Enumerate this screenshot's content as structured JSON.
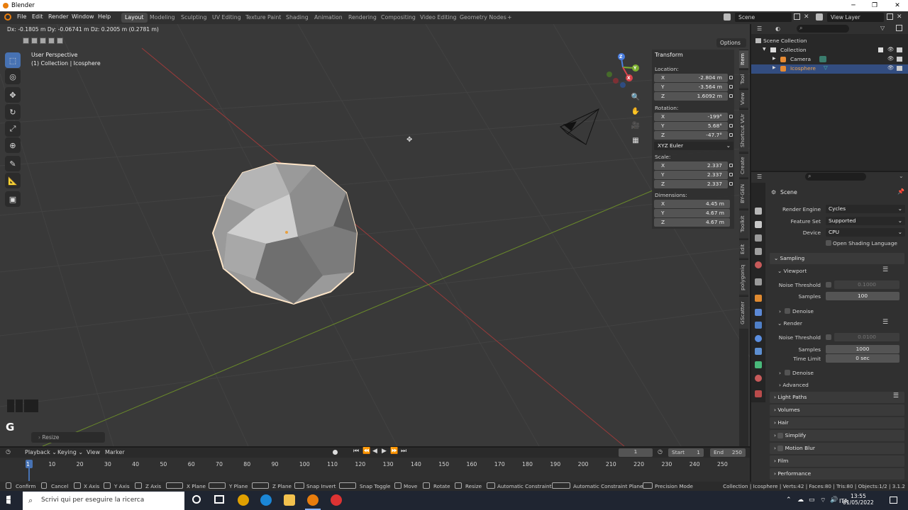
{
  "window": {
    "title": "Blender",
    "min": "─",
    "max": "❐",
    "close": "✕"
  },
  "menu": {
    "items": [
      "File",
      "Edit",
      "Render",
      "Window",
      "Help"
    ]
  },
  "workspaces": [
    "Layout",
    "Modeling",
    "Sculpting",
    "UV Editing",
    "Texture Paint",
    "Shading",
    "Animation",
    "Rendering",
    "Compositing",
    "Video Editing",
    "Geometry Nodes",
    "+"
  ],
  "scene": {
    "name": "Scene",
    "view_layer": "View Layer"
  },
  "viewport": {
    "status": "Dx: -0.1805 m  Dy: -0.06741 m  Dz: 0.2005 m (0.2781 m)",
    "perspective": "User Perspective",
    "collection_info": "(1) Collection | Icosphere",
    "options_label": "Options",
    "gizmo_x": "X",
    "gizmo_y": "Y",
    "gizmo_z": "Z",
    "grab_key": "G",
    "last_op": "Resize"
  },
  "npanel": {
    "title": "Transform",
    "location_label": "Location:",
    "location": [
      {
        "k": "X",
        "v": "-2.804 m"
      },
      {
        "k": "Y",
        "v": "-3.564 m"
      },
      {
        "k": "Z",
        "v": "1.6092 m"
      }
    ],
    "rotation_label": "Rotation:",
    "rotation": [
      {
        "k": "X",
        "v": "-199°"
      },
      {
        "k": "Y",
        "v": "5.68°"
      },
      {
        "k": "Z",
        "v": "-47.7°"
      }
    ],
    "rotation_mode": "XYZ Euler",
    "scale_label": "Scale:",
    "scale": [
      {
        "k": "X",
        "v": "2.337"
      },
      {
        "k": "Y",
        "v": "2.337"
      },
      {
        "k": "Z",
        "v": "2.337"
      }
    ],
    "dimensions_label": "Dimensions:",
    "dimensions": [
      {
        "k": "X",
        "v": "4.45 m"
      },
      {
        "k": "Y",
        "v": "4.67 m"
      },
      {
        "k": "Z",
        "v": "4.67 m"
      }
    ]
  },
  "sidebar_tabs": [
    "Item",
    "Tool",
    "View",
    "Shortcut VUr",
    "Create",
    "BY-GEN",
    "Toolkit",
    "Edit",
    "polygoniq",
    "GScatter"
  ],
  "outliner": {
    "rows": [
      "Scene Collection",
      "Collection",
      "Camera",
      "Icosphere"
    ]
  },
  "properties": {
    "context": "Scene",
    "render_engine_label": "Render Engine",
    "render_engine": "Cycles",
    "feature_set_label": "Feature Set",
    "feature_set": "Supported",
    "device_label": "Device",
    "device": "CPU",
    "osl_label": "Open Shading Language",
    "sampling": "Sampling",
    "viewport_sub": "Viewport",
    "noise_threshold_label": "Noise Threshold",
    "vp_noise": "0.1000",
    "samples_label": "Samples",
    "vp_samples": "100",
    "denoise": "Denoise",
    "render_sub": "Render",
    "r_noise": "0.0100",
    "r_samples": "1000",
    "time_limit_label": "Time Limit",
    "time_limit": "0 sec",
    "denoise2": "Denoise",
    "advanced": "Advanced",
    "sections": [
      "Light Paths",
      "Volumes",
      "Hair",
      "Simplify",
      "Motion Blur",
      "Film",
      "Performance"
    ]
  },
  "timeline": {
    "playback": "Playback",
    "keying": "Keying",
    "view": "View",
    "marker": "Marker",
    "current_frame": "1",
    "start_label": "Start",
    "start": "1",
    "end_label": "End",
    "end": "250",
    "frames": [
      "1",
      "10",
      "20",
      "30",
      "40",
      "50",
      "60",
      "70",
      "80",
      "90",
      "100",
      "110",
      "120",
      "130",
      "140",
      "150",
      "160",
      "170",
      "180",
      "190",
      "200",
      "210",
      "220",
      "230",
      "240",
      "250"
    ]
  },
  "footer": {
    "hints": [
      "Confirm",
      "Cancel",
      "X Axis",
      "Y Axis",
      "Z Axis",
      "X Plane",
      "Y Plane",
      "Z Plane",
      "Snap Invert",
      "Snap Toggle",
      "Move",
      "Rotate",
      "Resize",
      "Automatic Constraint",
      "Automatic Constraint Plane",
      "Precision Mode"
    ],
    "stats": "Collection | Icosphere | Verts:42 | Faces:80 | Tris:80 | Objects:1/2 | 3.1.2"
  },
  "taskbar": {
    "search_placeholder": "Scrivi qui per eseguire la ricerca",
    "lang": "ITA",
    "time": "13:55",
    "date": "01/05/2022"
  }
}
